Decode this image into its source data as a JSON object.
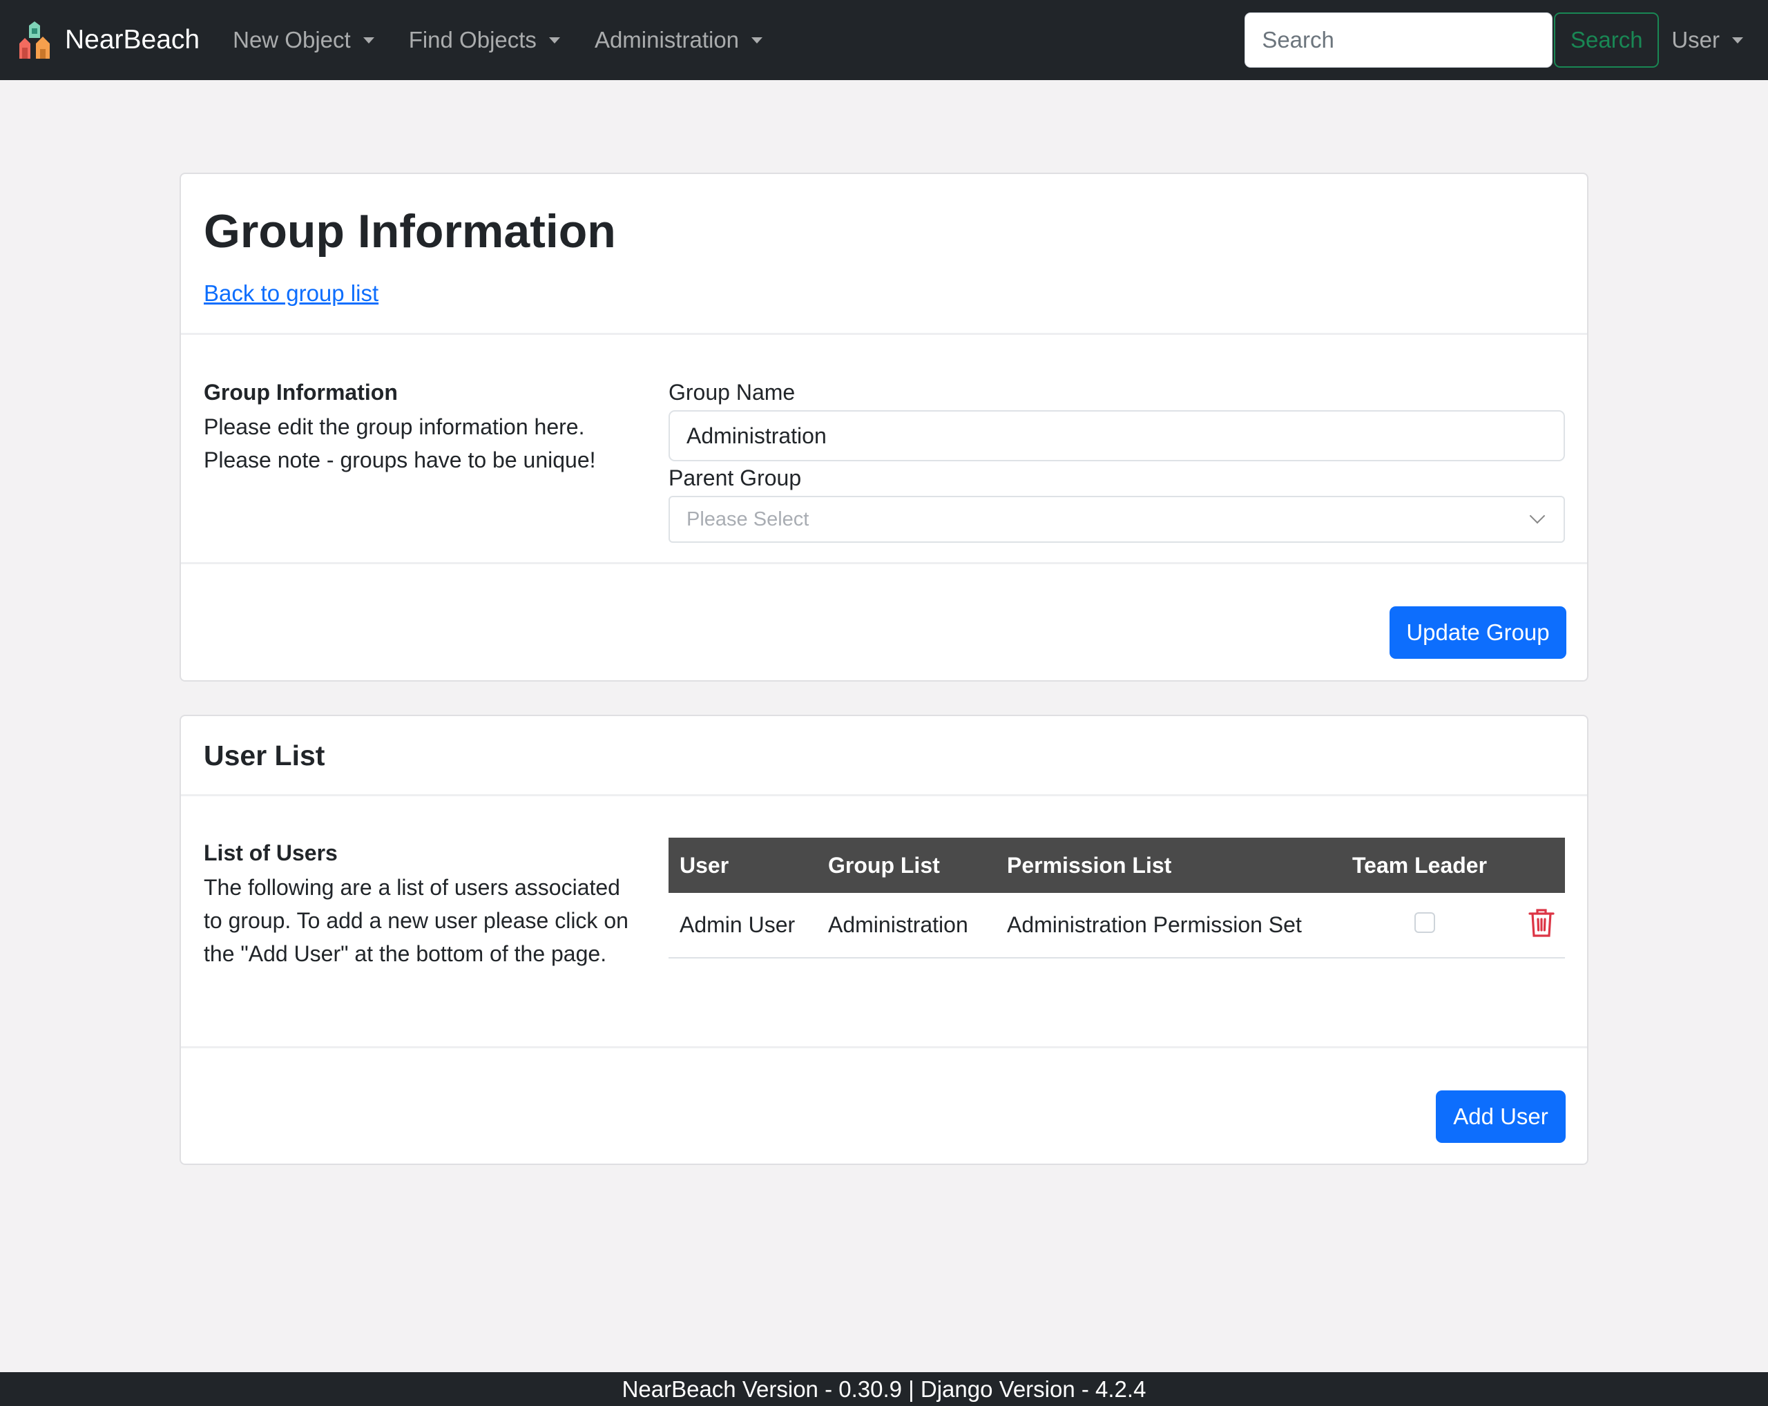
{
  "navbar": {
    "brand": "NearBeach",
    "menus": [
      {
        "label": "New Object"
      },
      {
        "label": "Find Objects"
      },
      {
        "label": "Administration"
      }
    ],
    "search_placeholder": "Search",
    "search_button": "Search",
    "user_menu": "User"
  },
  "group_card": {
    "title": "Group Information",
    "back_link": "Back to group list",
    "section_label": "Group Information",
    "section_desc_1": "Please edit the group information here.",
    "section_desc_2": "Please note - groups have to be unique!",
    "group_name_label": "Group Name",
    "group_name_value": "Administration",
    "parent_group_label": "Parent Group",
    "parent_group_placeholder": "Please Select",
    "update_button": "Update Group"
  },
  "user_card": {
    "title": "User List",
    "section_label": "List of Users",
    "section_desc": "The following are a list of users associated to group. To add a new user please click on the \"Add User\" at the bottom of the page.",
    "table": {
      "columns": [
        "User",
        "Group List",
        "Permission List",
        "Team Leader"
      ],
      "rows": [
        {
          "user": "Admin User",
          "group": "Administration",
          "permission": "Administration Permission Set",
          "team_leader": false
        }
      ]
    },
    "add_button": "Add User"
  },
  "footer": {
    "text": "NearBeach Version - 0.30.9 | Django Version - 4.2.4"
  },
  "colors": {
    "navbar_bg": "#212529",
    "primary": "#0d6efd",
    "success": "#198754",
    "danger": "#dc3545",
    "page_bg": "#f3f2f3",
    "table_header_bg": "#4a4a4a"
  }
}
